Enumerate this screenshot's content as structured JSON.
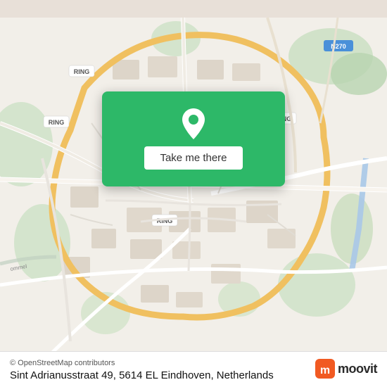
{
  "map": {
    "center_lat": 51.437,
    "center_lng": 5.478,
    "city": "Eindhoven"
  },
  "cta": {
    "button_label": "Take me there",
    "pin_icon": "map-pin"
  },
  "address": {
    "full": "Sint Adrianusstraat 49, 5614 EL Eindhoven, Netherlands",
    "street": "Sint Adrianusstraat 49, 5614 EL Eindhoven,",
    "country": "Netherlands"
  },
  "attribution": {
    "text": "© OpenStreetMap contributors"
  },
  "branding": {
    "name": "moovit"
  }
}
